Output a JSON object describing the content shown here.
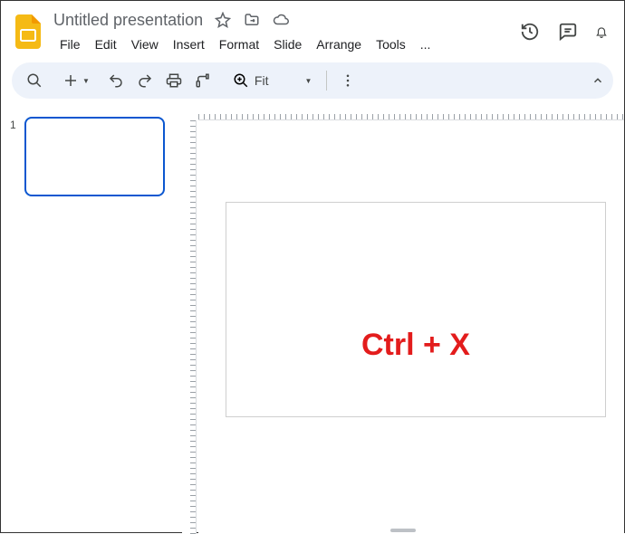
{
  "header": {
    "title": "Untitled presentation"
  },
  "menubar": {
    "file": "File",
    "edit": "Edit",
    "view": "View",
    "insert": "Insert",
    "format": "Format",
    "slide": "Slide",
    "arrange": "Arrange",
    "tools": "Tools",
    "more": "..."
  },
  "toolbar": {
    "zoom_label": "Fit"
  },
  "filmstrip": {
    "slides": [
      {
        "number": "1"
      }
    ]
  },
  "annotation": {
    "text": "Ctrl + X"
  }
}
